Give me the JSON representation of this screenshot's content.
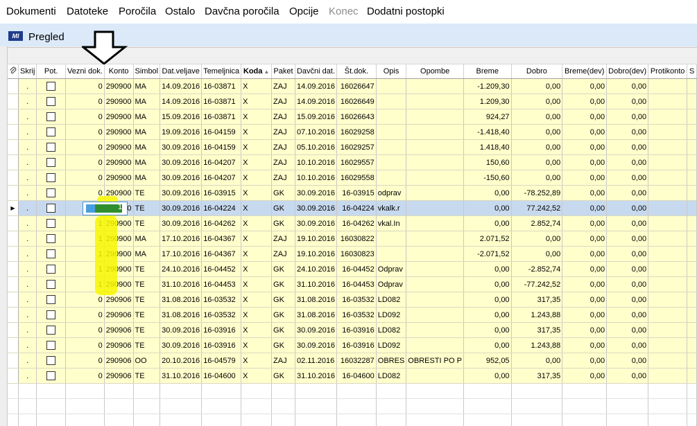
{
  "menu": [
    "Dokumenti",
    "Datoteke",
    "Poročila",
    "Ostalo",
    "Davčna poročila",
    "Opcije",
    "Konec",
    "Dodatni postopki"
  ],
  "window": {
    "logo": "MI",
    "title": "Pregled"
  },
  "columns": [
    "",
    "Skrij",
    "Pot.",
    "Vezni dok.",
    "Konto",
    "Simbol",
    "Dat.veljave",
    "Temeljnica",
    "Koda",
    "Paket",
    "Davčni dat.",
    "Št.dok.",
    "Opis",
    "Opombe",
    "Breme",
    "Dobro",
    "Breme(dev)",
    "Dobro(dev)",
    "Protikonto",
    "S"
  ],
  "rows": [
    {
      "skrij": ".",
      "vezni": "0",
      "konto": "290900",
      "simbol": "MA",
      "dat": "14.09.2016",
      "tem": "16-03871",
      "koda": "X",
      "paket": "ZAJ",
      "ddat": "14.09.2016",
      "stdok": "16026647",
      "opis": "",
      "opombe": "",
      "breme": "-1.209,30",
      "dobro": "0,00",
      "bdev": "0,00",
      "ddev": "0,00"
    },
    {
      "skrij": ".",
      "vezni": "0",
      "konto": "290900",
      "simbol": "MA",
      "dat": "14.09.2016",
      "tem": "16-03871",
      "koda": "X",
      "paket": "ZAJ",
      "ddat": "14.09.2016",
      "stdok": "16026649",
      "opis": "",
      "opombe": "",
      "breme": "1.209,30",
      "dobro": "0,00",
      "bdev": "0,00",
      "ddev": "0,00"
    },
    {
      "skrij": ".",
      "vezni": "0",
      "konto": "290900",
      "simbol": "MA",
      "dat": "15.09.2016",
      "tem": "16-03871",
      "koda": "X",
      "paket": "ZAJ",
      "ddat": "15.09.2016",
      "stdok": "16026643",
      "opis": "",
      "opombe": "",
      "breme": "924,27",
      "dobro": "0,00",
      "bdev": "0,00",
      "ddev": "0,00"
    },
    {
      "skrij": ".",
      "vezni": "0",
      "konto": "290900",
      "simbol": "MA",
      "dat": "19.09.2016",
      "tem": "16-04159",
      "koda": "X",
      "paket": "ZAJ",
      "ddat": "07.10.2016",
      "stdok": "16029258",
      "opis": "",
      "opombe": "",
      "breme": "-1.418,40",
      "dobro": "0,00",
      "bdev": "0,00",
      "ddev": "0,00"
    },
    {
      "skrij": ".",
      "vezni": "0",
      "konto": "290900",
      "simbol": "MA",
      "dat": "30.09.2016",
      "tem": "16-04159",
      "koda": "X",
      "paket": "ZAJ",
      "ddat": "05.10.2016",
      "stdok": "16029257",
      "opis": "",
      "opombe": "",
      "breme": "1.418,40",
      "dobro": "0,00",
      "bdev": "0,00",
      "ddev": "0,00"
    },
    {
      "skrij": ".",
      "vezni": "0",
      "konto": "290900",
      "simbol": "MA",
      "dat": "30.09.2016",
      "tem": "16-04207",
      "koda": "X",
      "paket": "ZAJ",
      "ddat": "10.10.2016",
      "stdok": "16029557",
      "opis": "",
      "opombe": "",
      "breme": "150,60",
      "dobro": "0,00",
      "bdev": "0,00",
      "ddev": "0,00"
    },
    {
      "skrij": ".",
      "vezni": "0",
      "konto": "290900",
      "simbol": "MA",
      "dat": "30.09.2016",
      "tem": "16-04207",
      "koda": "X",
      "paket": "ZAJ",
      "ddat": "10.10.2016",
      "stdok": "16029558",
      "opis": "",
      "opombe": "",
      "breme": "-150,60",
      "dobro": "0,00",
      "bdev": "0,00",
      "ddev": "0,00"
    },
    {
      "skrij": ".",
      "vezni": "0",
      "konto": "290900",
      "simbol": "TE",
      "dat": "30.09.2016",
      "tem": "16-03915",
      "koda": "X",
      "paket": "GK",
      "ddat": "30.09.2016",
      "stdok": "16-03915",
      "opis": "odprav",
      "opombe": "",
      "breme": "0,00",
      "dobro": "-78.252,89",
      "bdev": "0,00",
      "ddev": "0,00"
    },
    {
      "skrij": ".",
      "vezni": "1",
      "konto": "290900",
      "simbol": "TE",
      "dat": "30.09.2016",
      "tem": "16-04224",
      "koda": "X",
      "paket": "GK",
      "ddat": "30.09.2016",
      "stdok": "16-04224",
      "opis": "vkalk.r",
      "opombe": "",
      "breme": "0,00",
      "dobro": "77.242,52",
      "bdev": "0,00",
      "ddev": "0,00",
      "selected": true
    },
    {
      "skrij": ".",
      "vezni": "1",
      "konto": "290900",
      "simbol": "TE",
      "dat": "30.09.2016",
      "tem": "16-04262",
      "koda": "X",
      "paket": "GK",
      "ddat": "30.09.2016",
      "stdok": "16-04262",
      "opis": "vkal.In",
      "opombe": "",
      "breme": "0,00",
      "dobro": "2.852,74",
      "bdev": "0,00",
      "ddev": "0,00"
    },
    {
      "skrij": ".",
      "vezni": "1",
      "konto": "290900",
      "simbol": "MA",
      "dat": "17.10.2016",
      "tem": "16-04367",
      "koda": "X",
      "paket": "ZAJ",
      "ddat": "19.10.2016",
      "stdok": "16030822",
      "opis": "",
      "opombe": "",
      "breme": "2.071,52",
      "dobro": "0,00",
      "bdev": "0,00",
      "ddev": "0,00"
    },
    {
      "skrij": ".",
      "vezni": "1",
      "konto": "290900",
      "simbol": "MA",
      "dat": "17.10.2016",
      "tem": "16-04367",
      "koda": "X",
      "paket": "ZAJ",
      "ddat": "19.10.2016",
      "stdok": "16030823",
      "opis": "",
      "opombe": "",
      "breme": "-2.071,52",
      "dobro": "0,00",
      "bdev": "0,00",
      "ddev": "0,00"
    },
    {
      "skrij": ".",
      "vezni": "1",
      "konto": "290900",
      "simbol": "TE",
      "dat": "24.10.2016",
      "tem": "16-04452",
      "koda": "X",
      "paket": "GK",
      "ddat": "24.10.2016",
      "stdok": "16-04452",
      "opis": "Odprav",
      "opombe": "",
      "breme": "0,00",
      "dobro": "-2.852,74",
      "bdev": "0,00",
      "ddev": "0,00"
    },
    {
      "skrij": ".",
      "vezni": "1",
      "konto": "290900",
      "simbol": "TE",
      "dat": "31.10.2016",
      "tem": "16-04453",
      "koda": "X",
      "paket": "GK",
      "ddat": "31.10.2016",
      "stdok": "16-04453",
      "opis": "Odprav",
      "opombe": "",
      "breme": "0,00",
      "dobro": "-77.242,52",
      "bdev": "0,00",
      "ddev": "0,00"
    },
    {
      "skrij": ".",
      "vezni": "0",
      "konto": "290906",
      "simbol": "TE",
      "dat": "31.08.2016",
      "tem": "16-03532",
      "koda": "X",
      "paket": "GK",
      "ddat": "31.08.2016",
      "stdok": "16-03532",
      "opis": "LD082",
      "opombe": "",
      "breme": "0,00",
      "dobro": "317,35",
      "bdev": "0,00",
      "ddev": "0,00"
    },
    {
      "skrij": ".",
      "vezni": "0",
      "konto": "290906",
      "simbol": "TE",
      "dat": "31.08.2016",
      "tem": "16-03532",
      "koda": "X",
      "paket": "GK",
      "ddat": "31.08.2016",
      "stdok": "16-03532",
      "opis": "LD092",
      "opombe": "",
      "breme": "0,00",
      "dobro": "1.243,88",
      "bdev": "0,00",
      "ddev": "0,00"
    },
    {
      "skrij": ".",
      "vezni": "0",
      "konto": "290906",
      "simbol": "TE",
      "dat": "30.09.2016",
      "tem": "16-03916",
      "koda": "X",
      "paket": "GK",
      "ddat": "30.09.2016",
      "stdok": "16-03916",
      "opis": "LD082",
      "opombe": "",
      "breme": "0,00",
      "dobro": "317,35",
      "bdev": "0,00",
      "ddev": "0,00"
    },
    {
      "skrij": ".",
      "vezni": "0",
      "konto": "290906",
      "simbol": "TE",
      "dat": "30.09.2016",
      "tem": "16-03916",
      "koda": "X",
      "paket": "GK",
      "ddat": "30.09.2016",
      "stdok": "16-03916",
      "opis": "LD092",
      "opombe": "",
      "breme": "0,00",
      "dobro": "1.243,88",
      "bdev": "0,00",
      "ddev": "0,00"
    },
    {
      "skrij": ".",
      "vezni": "0",
      "konto": "290906",
      "simbol": "OO",
      "dat": "20.10.2016",
      "tem": "16-04579",
      "koda": "X",
      "paket": "ZAJ",
      "ddat": "02.11.2016",
      "stdok": "16032287",
      "opis": "OBRES",
      "opombe": "OBRESTI PO P",
      "breme": "952,05",
      "dobro": "0,00",
      "bdev": "0,00",
      "ddev": "0,00"
    },
    {
      "skrij": ".",
      "vezni": "0",
      "konto": "290906",
      "simbol": "TE",
      "dat": "31.10.2016",
      "tem": "16-04600",
      "koda": "X",
      "paket": "GK",
      "ddat": "31.10.2016",
      "stdok": "16-04600",
      "opis": "LD082",
      "opombe": "",
      "breme": "0,00",
      "dobro": "317,35",
      "bdev": "0,00",
      "ddev": "0,00"
    }
  ],
  "empty_rows": 3,
  "colors": {
    "row_bg": "#ffffcc",
    "selected_bg": "#c7d9ee",
    "highlight": "#f7f700"
  }
}
